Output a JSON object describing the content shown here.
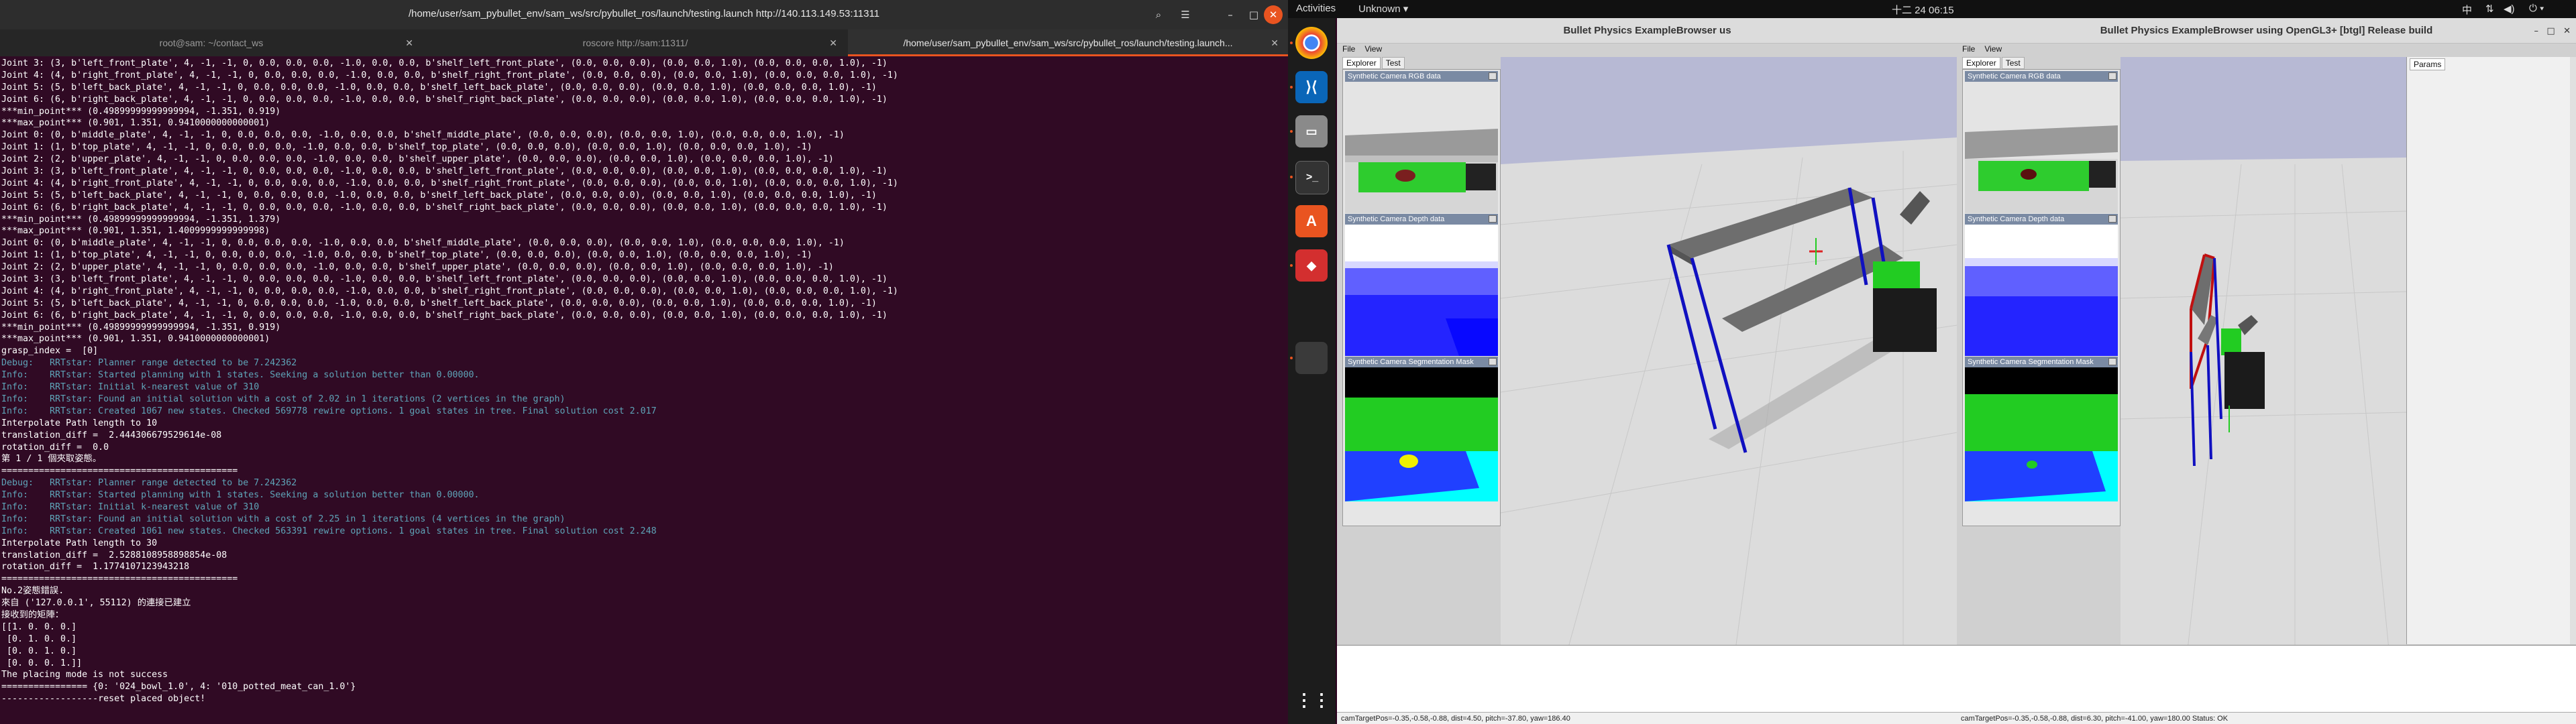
{
  "terminal": {
    "title": "/home/user/sam_pybullet_env/sam_ws/src/pybullet_ros/launch/testing.launch http://140.113.149.53:11311",
    "tabs": [
      {
        "label": "root@sam: ~/contact_ws"
      },
      {
        "label": "roscore http://sam:11311/"
      },
      {
        "label": "/home/user/sam_pybullet_env/sam_ws/src/pybullet_ros/launch/testing.launch..."
      }
    ],
    "lines": [
      {
        "t": "Joint 3: (3, b'left_front_plate', 4, -1, -1, 0, 0.0, 0.0, 0.0, -1.0, 0.0, 0.0, b'shelf_left_front_plate', (0.0, 0.0, 0.0), (0.0, 0.0, 1.0), (0.0, 0.0, 0.0, 1.0), -1)",
        "c": 0
      },
      {
        "t": "Joint 4: (4, b'right_front_plate', 4, -1, -1, 0, 0.0, 0.0, 0.0, -1.0, 0.0, 0.0, b'shelf_right_front_plate', (0.0, 0.0, 0.0), (0.0, 0.0, 1.0), (0.0, 0.0, 0.0, 1.0), -1)",
        "c": 0
      },
      {
        "t": "Joint 5: (5, b'left_back_plate', 4, -1, -1, 0, 0.0, 0.0, 0.0, -1.0, 0.0, 0.0, b'shelf_left_back_plate', (0.0, 0.0, 0.0), (0.0, 0.0, 1.0), (0.0, 0.0, 0.0, 1.0), -1)",
        "c": 0
      },
      {
        "t": "Joint 6: (6, b'right_back_plate', 4, -1, -1, 0, 0.0, 0.0, 0.0, -1.0, 0.0, 0.0, b'shelf_right_back_plate', (0.0, 0.0, 0.0), (0.0, 0.0, 1.0), (0.0, 0.0, 0.0, 1.0), -1)",
        "c": 0
      },
      {
        "t": "***min_point*** (0.49899999999999994, -1.351, 0.919)",
        "c": 0
      },
      {
        "t": "***max_point*** (0.901, 1.351, 0.9410000000000001)",
        "c": 0
      },
      {
        "t": "Joint 0: (0, b'middle_plate', 4, -1, -1, 0, 0.0, 0.0, 0.0, -1.0, 0.0, 0.0, b'shelf_middle_plate', (0.0, 0.0, 0.0), (0.0, 0.0, 1.0), (0.0, 0.0, 0.0, 1.0), -1)",
        "c": 0
      },
      {
        "t": "Joint 1: (1, b'top_plate', 4, -1, -1, 0, 0.0, 0.0, 0.0, -1.0, 0.0, 0.0, b'shelf_top_plate', (0.0, 0.0, 0.0), (0.0, 0.0, 1.0), (0.0, 0.0, 0.0, 1.0), -1)",
        "c": 0
      },
      {
        "t": "Joint 2: (2, b'upper_plate', 4, -1, -1, 0, 0.0, 0.0, 0.0, -1.0, 0.0, 0.0, b'shelf_upper_plate', (0.0, 0.0, 0.0), (0.0, 0.0, 1.0), (0.0, 0.0, 0.0, 1.0), -1)",
        "c": 0
      },
      {
        "t": "Joint 3: (3, b'left_front_plate', 4, -1, -1, 0, 0.0, 0.0, 0.0, -1.0, 0.0, 0.0, b'shelf_left_front_plate', (0.0, 0.0, 0.0), (0.0, 0.0, 1.0), (0.0, 0.0, 0.0, 1.0), -1)",
        "c": 0
      },
      {
        "t": "Joint 4: (4, b'right_front_plate', 4, -1, -1, 0, 0.0, 0.0, 0.0, -1.0, 0.0, 0.0, b'shelf_right_front_plate', (0.0, 0.0, 0.0), (0.0, 0.0, 1.0), (0.0, 0.0, 0.0, 1.0), -1)",
        "c": 0
      },
      {
        "t": "Joint 5: (5, b'left_back_plate', 4, -1, -1, 0, 0.0, 0.0, 0.0, -1.0, 0.0, 0.0, b'shelf_left_back_plate', (0.0, 0.0, 0.0), (0.0, 0.0, 1.0), (0.0, 0.0, 0.0, 1.0), -1)",
        "c": 0
      },
      {
        "t": "Joint 6: (6, b'right_back_plate', 4, -1, -1, 0, 0.0, 0.0, 0.0, -1.0, 0.0, 0.0, b'shelf_right_back_plate', (0.0, 0.0, 0.0), (0.0, 0.0, 1.0), (0.0, 0.0, 0.0, 1.0), -1)",
        "c": 0
      },
      {
        "t": "***min_point*** (0.49899999999999994, -1.351, 1.379)",
        "c": 0
      },
      {
        "t": "***max_point*** (0.901, 1.351, 1.4009999999999998)",
        "c": 0
      },
      {
        "t": "Joint 0: (0, b'middle_plate', 4, -1, -1, 0, 0.0, 0.0, 0.0, -1.0, 0.0, 0.0, b'shelf_middle_plate', (0.0, 0.0, 0.0), (0.0, 0.0, 1.0), (0.0, 0.0, 0.0, 1.0), -1)",
        "c": 0
      },
      {
        "t": "Joint 1: (1, b'top_plate', 4, -1, -1, 0, 0.0, 0.0, 0.0, -1.0, 0.0, 0.0, b'shelf_top_plate', (0.0, 0.0, 0.0), (0.0, 0.0, 1.0), (0.0, 0.0, 0.0, 1.0), -1)",
        "c": 0
      },
      {
        "t": "Joint 2: (2, b'upper_plate', 4, -1, -1, 0, 0.0, 0.0, 0.0, -1.0, 0.0, 0.0, b'shelf_upper_plate', (0.0, 0.0, 0.0), (0.0, 0.0, 1.0), (0.0, 0.0, 0.0, 1.0), -1)",
        "c": 0
      },
      {
        "t": "Joint 3: (3, b'left_front_plate', 4, -1, -1, 0, 0.0, 0.0, 0.0, -1.0, 0.0, 0.0, b'shelf_left_front_plate', (0.0, 0.0, 0.0), (0.0, 0.0, 1.0), (0.0, 0.0, 0.0, 1.0), -1)",
        "c": 0
      },
      {
        "t": "Joint 4: (4, b'right_front_plate', 4, -1, -1, 0, 0.0, 0.0, 0.0, -1.0, 0.0, 0.0, b'shelf_right_front_plate', (0.0, 0.0, 0.0), (0.0, 0.0, 1.0), (0.0, 0.0, 0.0, 1.0), -1)",
        "c": 0
      },
      {
        "t": "Joint 5: (5, b'left_back_plate', 4, -1, -1, 0, 0.0, 0.0, 0.0, -1.0, 0.0, 0.0, b'shelf_left_back_plate', (0.0, 0.0, 0.0), (0.0, 0.0, 1.0), (0.0, 0.0, 0.0, 1.0), -1)",
        "c": 0
      },
      {
        "t": "Joint 6: (6, b'right_back_plate', 4, -1, -1, 0, 0.0, 0.0, 0.0, -1.0, 0.0, 0.0, b'shelf_right_back_plate', (0.0, 0.0, 0.0), (0.0, 0.0, 1.0), (0.0, 0.0, 0.0, 1.0), -1)",
        "c": 0
      },
      {
        "t": "***min_point*** (0.49899999999999994, -1.351, 0.919)",
        "c": 0
      },
      {
        "t": "***max_point*** (0.901, 1.351, 0.9410000000000001)",
        "c": 0
      },
      {
        "t": "grasp_index =  [0]",
        "c": 0
      },
      {
        "t": "Debug:   RRTstar: Planner range detected to be 7.242362",
        "c": 1
      },
      {
        "t": "Info:    RRTstar: Started planning with 1 states. Seeking a solution better than 0.00000.",
        "c": 1
      },
      {
        "t": "Info:    RRTstar: Initial k-nearest value of 310",
        "c": 1
      },
      {
        "t": "Info:    RRTstar: Found an initial solution with a cost of 2.02 in 1 iterations (2 vertices in the graph)",
        "c": 1
      },
      {
        "t": "Info:    RRTstar: Created 1067 new states. Checked 569778 rewire options. 1 goal states in tree. Final solution cost 2.017",
        "c": 1
      },
      {
        "t": "Interpolate Path length to 10",
        "c": 0
      },
      {
        "t": "translation_diff =  2.444306679529614e-08",
        "c": 0
      },
      {
        "t": "rotation_diff =  0.0",
        "c": 0
      },
      {
        "t": "第 1 / 1 個夾取姿態。",
        "c": 0
      },
      {
        "t": "============================================",
        "c": 0
      },
      {
        "t": "Debug:   RRTstar: Planner range detected to be 7.242362",
        "c": 1
      },
      {
        "t": "Info:    RRTstar: Started planning with 1 states. Seeking a solution better than 0.00000.",
        "c": 1
      },
      {
        "t": "Info:    RRTstar: Initial k-nearest value of 310",
        "c": 1
      },
      {
        "t": "Info:    RRTstar: Found an initial solution with a cost of 2.25 in 1 iterations (4 vertices in the graph)",
        "c": 1
      },
      {
        "t": "Info:    RRTstar: Created 1061 new states. Checked 563391 rewire options. 1 goal states in tree. Final solution cost 2.248",
        "c": 1
      },
      {
        "t": "Interpolate Path length to 30",
        "c": 0
      },
      {
        "t": "translation_diff =  2.5288108958898854e-08",
        "c": 0
      },
      {
        "t": "rotation_diff =  1.1774107123943218",
        "c": 0
      },
      {
        "t": "============================================",
        "c": 0
      },
      {
        "t": "No.2姿態錯誤.",
        "c": 0
      },
      {
        "t": "來自 ('127.0.0.1', 55112) 的連接已建立",
        "c": 0
      },
      {
        "t": "接收到的矩陣：",
        "c": 0
      },
      {
        "t": "[[1. 0. 0. 0.]",
        "c": 0
      },
      {
        "t": " [0. 1. 0. 0.]",
        "c": 0
      },
      {
        "t": " [0. 0. 1. 0.]",
        "c": 0
      },
      {
        "t": " [0. 0. 0. 1.]]",
        "c": 0
      },
      {
        "t": "The placing mode is not success",
        "c": 0
      },
      {
        "t": "================ {0: '024_bowl_1.0', 4: '010_potted_meat_can_1.0'}",
        "c": 0
      },
      {
        "t": "------------------reset placed object!",
        "c": 0
      }
    ]
  },
  "topbar": {
    "activities": "Activities",
    "app_menu": "Unknown ▾",
    "clock": "十二 24 06:15",
    "lang": "中"
  },
  "bullet_left": {
    "title": "Bullet Physics ExampleBrowser us",
    "menu": [
      "File",
      "View"
    ],
    "tabs": [
      "Explorer",
      "Test"
    ],
    "cam_rgb": "Synthetic Camera RGB data",
    "cam_depth": "Synthetic Camera Depth data",
    "cam_seg": "Synthetic Camera Segmentation Mask",
    "status": "camTargetPos=-0.35,-0.58,-0.88, dist=4.50, pitch=-37.80, yaw=186.40"
  },
  "bullet_right": {
    "title": "Bullet Physics ExampleBrowser using OpenGL3+ [btgl] Release build",
    "menu": [
      "File",
      "View"
    ],
    "tabs": [
      "Explorer",
      "Test"
    ],
    "params_tab": "Params",
    "cam_rgb": "Synthetic Camera RGB data",
    "cam_depth": "Synthetic Camera Depth data",
    "cam_seg": "Synthetic Camera Segmentation Mask",
    "status": "camTargetPos=-0.35,-0.58,-0.88, dist=6.30, pitch=-41.00, yaw=180.00  Status: OK"
  },
  "colors": {
    "terminal_bg": "#300a24",
    "accent": "#e95420",
    "info_text": "#5ea4b8"
  }
}
